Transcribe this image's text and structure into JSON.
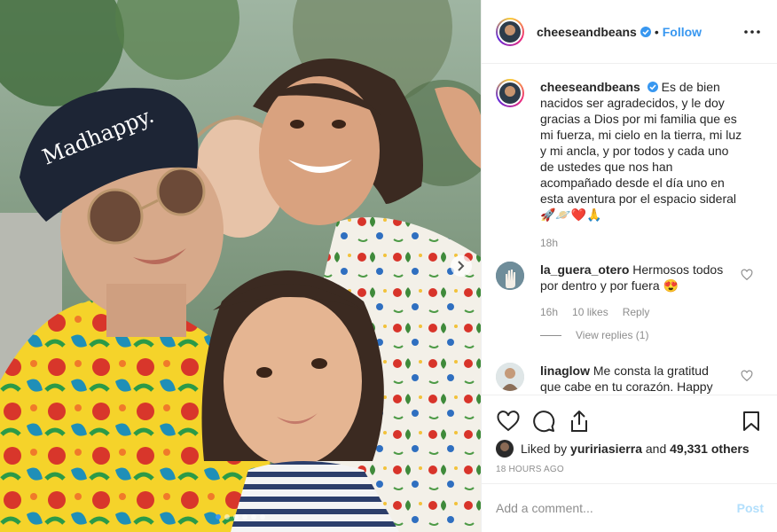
{
  "post": {
    "username": "cheeseandbeans",
    "follow_label": "Follow",
    "separator": "•",
    "caption": {
      "username": "cheeseandbeans",
      "text": "Es de bien nacidos ser agradecidos, y le doy gracias a Dios por mi familia que es mi fuerza, mi cielo en la tierra, mi luz y mi ancla, y por todos y cada uno de ustedes que nos han acompañado desde el día uno en esta aventura por el espacio sideral 🚀🪐❤️🙏",
      "time": "18h"
    },
    "photo": {
      "cap_text": "Madhappy.",
      "carousel_count": 6,
      "carousel_active": 0
    }
  },
  "comments": [
    {
      "username": "la_guera_otero",
      "text": "Hermosos todos por dentro y por fuera 😍",
      "time": "16h",
      "likes": "10 likes",
      "reply": "Reply",
      "view_replies": "View replies (1)"
    },
    {
      "username": "linaglow",
      "text": "Me consta la gratitud que cabe en tu corazón. Happy thanksgiving para ti y toda tu"
    }
  ],
  "actions": {
    "liked_by_prefix": "Liked by",
    "liked_by_user": "yuririasierra",
    "liked_by_and": "and",
    "others": "49,331 others",
    "timestamp": "18 HOURS AGO"
  },
  "comment_box": {
    "placeholder": "Add a comment...",
    "post_label": "Post"
  },
  "colors": {
    "link_blue": "#3897f0",
    "post_disabled": "#b2dffc",
    "muted": "#8e8e8e"
  },
  "icons": [
    "verified-badge-icon",
    "more-options-icon",
    "heart-icon",
    "comment-icon",
    "share-icon",
    "bookmark-icon",
    "chevron-right-icon"
  ]
}
